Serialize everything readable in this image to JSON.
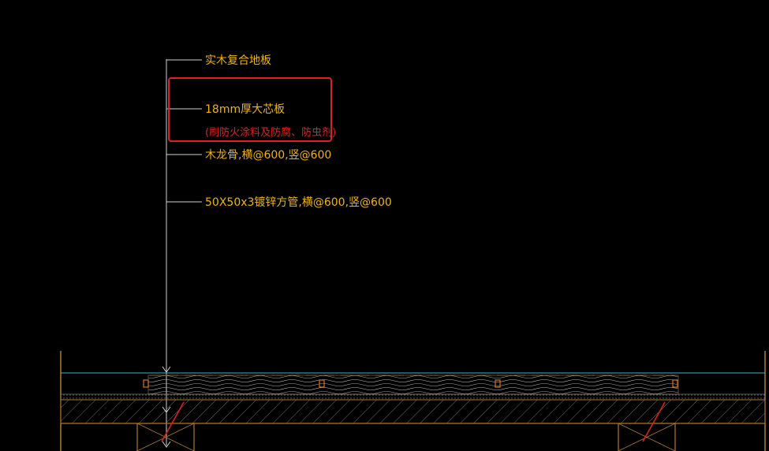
{
  "annotations": [
    {
      "text": "实木复合地板"
    },
    {
      "text": "18mm厚大芯板"
    },
    {
      "text": "(刷防火涂料及防腐、防虫剂)"
    },
    {
      "text": "木龙骨,横@600,竖@600"
    },
    {
      "text": "50X50x3镀锌方管,横@600,竖@600"
    }
  ],
  "colors": {
    "background": "#000000",
    "annotation_text": "#f5b400",
    "highlight_box": "#e0201e",
    "leader_line": "#cfcfcf",
    "floor_surface": "#3fb6c8",
    "wood_hatch": "#d9d9d9",
    "concrete": "#b07a2a"
  }
}
